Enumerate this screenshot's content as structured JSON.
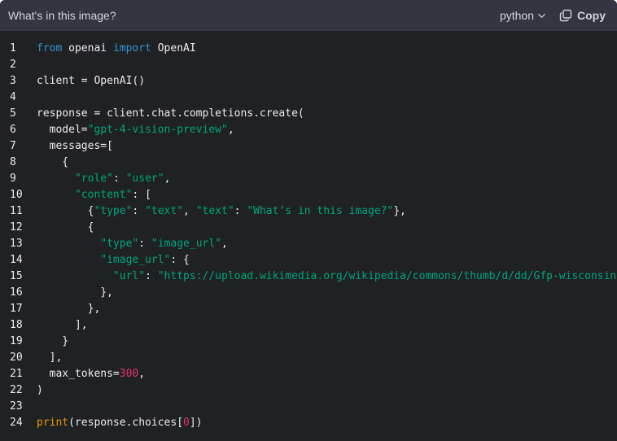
{
  "header": {
    "title": "What's in this image?",
    "language": "python",
    "copy_label": "Copy"
  },
  "icons": {
    "language_chevron": "chevron-down-icon",
    "copy": "copy-icon"
  },
  "colors": {
    "panel_bg": "#202123",
    "header_bg": "#343541",
    "keyword": "#2e95d3",
    "string": "#00a67d",
    "number": "#df3079",
    "builtin": "#e9950c",
    "text": "#ececf1"
  },
  "code": {
    "lines": [
      {
        "n": "1",
        "tokens": [
          {
            "t": "from",
            "c": "kw"
          },
          {
            "t": " openai ",
            "c": "plain"
          },
          {
            "t": "import",
            "c": "kw"
          },
          {
            "t": " OpenAI",
            "c": "plain"
          }
        ]
      },
      {
        "n": "2",
        "tokens": []
      },
      {
        "n": "3",
        "tokens": [
          {
            "t": "client = OpenAI()",
            "c": "plain"
          }
        ]
      },
      {
        "n": "4",
        "tokens": []
      },
      {
        "n": "5",
        "tokens": [
          {
            "t": "response = client.chat.completions.create(",
            "c": "plain"
          }
        ]
      },
      {
        "n": "6",
        "tokens": [
          {
            "t": "  model=",
            "c": "plain"
          },
          {
            "t": "\"gpt-4-vision-preview\"",
            "c": "str"
          },
          {
            "t": ",",
            "c": "plain"
          }
        ]
      },
      {
        "n": "7",
        "tokens": [
          {
            "t": "  messages=[",
            "c": "plain"
          }
        ]
      },
      {
        "n": "8",
        "tokens": [
          {
            "t": "    {",
            "c": "plain"
          }
        ]
      },
      {
        "n": "9",
        "tokens": [
          {
            "t": "      ",
            "c": "plain"
          },
          {
            "t": "\"role\"",
            "c": "str"
          },
          {
            "t": ": ",
            "c": "plain"
          },
          {
            "t": "\"user\"",
            "c": "str"
          },
          {
            "t": ",",
            "c": "plain"
          }
        ]
      },
      {
        "n": "10",
        "tokens": [
          {
            "t": "      ",
            "c": "plain"
          },
          {
            "t": "\"content\"",
            "c": "str"
          },
          {
            "t": ": [",
            "c": "plain"
          }
        ]
      },
      {
        "n": "11",
        "tokens": [
          {
            "t": "        {",
            "c": "plain"
          },
          {
            "t": "\"type\"",
            "c": "str"
          },
          {
            "t": ": ",
            "c": "plain"
          },
          {
            "t": "\"text\"",
            "c": "str"
          },
          {
            "t": ", ",
            "c": "plain"
          },
          {
            "t": "\"text\"",
            "c": "str"
          },
          {
            "t": ": ",
            "c": "plain"
          },
          {
            "t": "\"What’s in this image?\"",
            "c": "str"
          },
          {
            "t": "},",
            "c": "plain"
          }
        ]
      },
      {
        "n": "12",
        "tokens": [
          {
            "t": "        {",
            "c": "plain"
          }
        ]
      },
      {
        "n": "13",
        "tokens": [
          {
            "t": "          ",
            "c": "plain"
          },
          {
            "t": "\"type\"",
            "c": "str"
          },
          {
            "t": ": ",
            "c": "plain"
          },
          {
            "t": "\"image_url\"",
            "c": "str"
          },
          {
            "t": ",",
            "c": "plain"
          }
        ]
      },
      {
        "n": "14",
        "tokens": [
          {
            "t": "          ",
            "c": "plain"
          },
          {
            "t": "\"image_url\"",
            "c": "str"
          },
          {
            "t": ": {",
            "c": "plain"
          }
        ]
      },
      {
        "n": "15",
        "tokens": [
          {
            "t": "            ",
            "c": "plain"
          },
          {
            "t": "\"url\"",
            "c": "str"
          },
          {
            "t": ": ",
            "c": "plain"
          },
          {
            "t": "\"https://upload.wikimedia.org/wikipedia/commons/thumb/d/dd/Gfp-wisconsin-",
            "c": "str"
          }
        ]
      },
      {
        "n": "16",
        "tokens": [
          {
            "t": "          },",
            "c": "plain"
          }
        ]
      },
      {
        "n": "17",
        "tokens": [
          {
            "t": "        },",
            "c": "plain"
          }
        ]
      },
      {
        "n": "18",
        "tokens": [
          {
            "t": "      ],",
            "c": "plain"
          }
        ]
      },
      {
        "n": "19",
        "tokens": [
          {
            "t": "    }",
            "c": "plain"
          }
        ]
      },
      {
        "n": "20",
        "tokens": [
          {
            "t": "  ],",
            "c": "plain"
          }
        ]
      },
      {
        "n": "21",
        "tokens": [
          {
            "t": "  max_tokens=",
            "c": "plain"
          },
          {
            "t": "300",
            "c": "num"
          },
          {
            "t": ",",
            "c": "plain"
          }
        ]
      },
      {
        "n": "22",
        "tokens": [
          {
            "t": ")",
            "c": "plain"
          }
        ]
      },
      {
        "n": "23",
        "tokens": []
      },
      {
        "n": "24",
        "tokens": [
          {
            "t": "print",
            "c": "fn"
          },
          {
            "t": "(response.choices[",
            "c": "plain"
          },
          {
            "t": "0",
            "c": "num"
          },
          {
            "t": "])",
            "c": "plain"
          }
        ]
      }
    ]
  }
}
